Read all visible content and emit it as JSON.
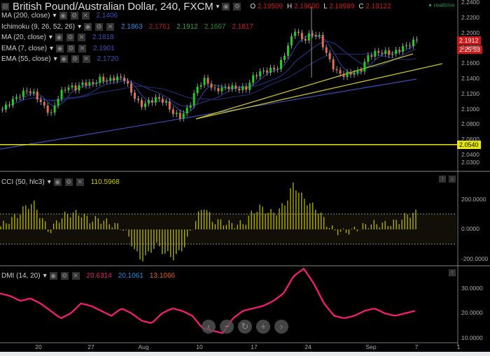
{
  "header": {
    "title": "British Pound/Australian Dollar, 240, FXCM",
    "ohlc": [
      {
        "k": "O",
        "v": "2.19509"
      },
      {
        "k": "H",
        "v": "2.19600"
      },
      {
        "k": "L",
        "v": "2.18989"
      },
      {
        "k": "C",
        "v": "2.19122"
      }
    ],
    "realtime": "realtime"
  },
  "indicators": [
    {
      "name": "MA (200, close)",
      "values": [
        {
          "v": "2.1406",
          "c": "#3a4fb8"
        }
      ]
    },
    {
      "name": "Ichimoku (9, 26, 52, 26)",
      "values": [
        {
          "v": "2.1863",
          "c": "#1e8fe0"
        },
        {
          "v": "2.1761",
          "c": "#b02020"
        },
        {
          "v": "2.1912",
          "c": "#3aa03a"
        },
        {
          "v": "2.1667",
          "c": "#2e8a2e"
        },
        {
          "v": "2.1817",
          "c": "#cc1a1a"
        }
      ]
    },
    {
      "name": "MA (20, close)",
      "values": [
        {
          "v": "2.1818",
          "c": "#3a4fb8"
        }
      ]
    },
    {
      "name": "EMA (7, close)",
      "values": [
        {
          "v": "2.1901",
          "c": "#3a4fb8"
        }
      ]
    },
    {
      "name": "EMA (55, close)",
      "values": [
        {
          "v": "2.1720",
          "c": "#3a4fb8"
        }
      ]
    }
  ],
  "cci": {
    "name": "CCI (50, hlc3)",
    "value": "110.5968",
    "color": "#c8c800"
  },
  "dmi": {
    "name": "DMI (14, 20)",
    "values": [
      {
        "v": "20.6314",
        "c": "#e0206a"
      },
      {
        "v": "20.1061",
        "c": "#1e8fe0"
      },
      {
        "v": "13.1066",
        "c": "#e06020"
      }
    ]
  },
  "price_tag": "2.1912",
  "timer_tag": "2:25:53",
  "hline_tag": "2.0540",
  "nav": [
    "‹",
    "−",
    "↻",
    "+",
    "›"
  ],
  "chart_data": {
    "type": "candlestick",
    "price_axis": [
      "2.2400",
      "2.2200",
      "2.2000",
      "2.1800",
      "2.1600",
      "2.1400",
      "2.1200",
      "2.1000",
      "2.0800",
      "2.0600",
      "2.0400",
      "2.0300"
    ],
    "price_ticks": [
      2.24,
      2.22,
      2.2,
      2.18,
      2.16,
      2.14,
      2.12,
      2.1,
      2.08,
      2.06,
      2.04,
      2.03
    ],
    "cci_axis": [
      "200.0000",
      "0.0000",
      "-200.0000"
    ],
    "dmi_axis": [
      "30.0000",
      "20.0000",
      "10.0000"
    ],
    "x_labels": [
      "20",
      "27",
      "Aug",
      "10",
      "17",
      "24",
      "Sep",
      "7",
      "1"
    ],
    "closes": [
      2.1,
      2.11,
      2.118,
      2.125,
      2.12,
      2.105,
      2.094,
      2.12,
      2.13,
      2.128,
      2.135,
      2.133,
      2.14,
      2.138,
      2.142,
      2.14,
      2.12,
      2.105,
      2.11,
      2.115,
      2.11,
      2.095,
      2.09,
      2.105,
      2.13,
      2.14,
      2.125,
      2.128,
      2.13,
      2.127,
      2.128,
      2.145,
      2.15,
      2.152,
      2.155,
      2.18,
      2.205,
      2.19,
      2.2,
      2.195,
      2.17,
      2.15,
      2.145,
      2.148,
      2.15,
      2.17,
      2.175,
      2.175,
      2.173,
      2.18,
      2.185,
      2.192
    ],
    "cci": [
      20,
      60,
      90,
      150,
      180,
      80,
      -20,
      60,
      100,
      110,
      100,
      60,
      70,
      50,
      30,
      10,
      -80,
      -200,
      -180,
      -100,
      -150,
      -190,
      -160,
      -60,
      70,
      160,
      60,
      50,
      40,
      30,
      45,
      120,
      150,
      110,
      120,
      180,
      310,
      220,
      170,
      130,
      40,
      -10,
      -20,
      -10,
      10,
      30,
      40,
      35,
      40,
      60,
      100,
      110
    ],
    "dmi_adx": [
      28,
      27,
      25,
      26,
      24,
      21,
      18,
      20,
      24,
      23,
      21,
      19,
      22,
      20,
      17,
      16,
      20,
      22,
      21,
      19,
      14,
      13,
      12,
      18,
      21,
      22,
      23,
      25,
      28,
      35,
      38,
      32,
      24,
      19,
      18,
      19,
      21,
      22,
      20,
      19,
      20,
      21
    ]
  }
}
